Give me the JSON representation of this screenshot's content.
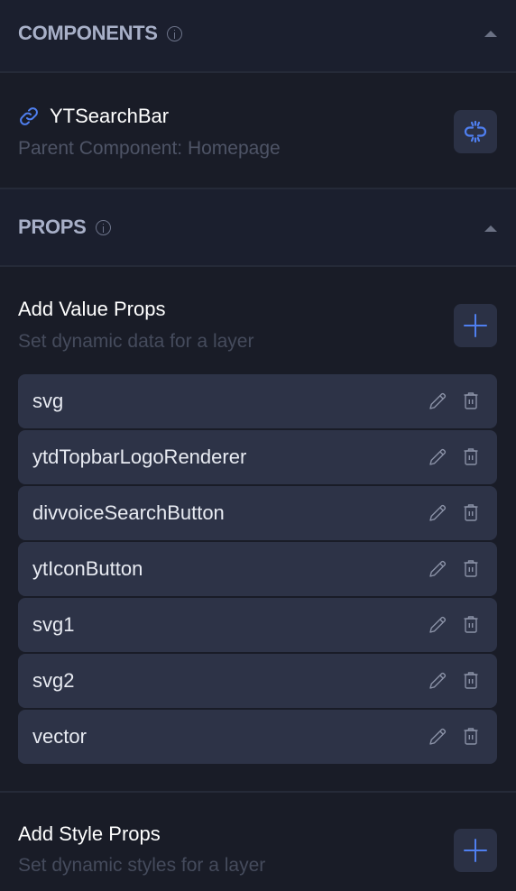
{
  "components_section": {
    "title": "COMPONENTS",
    "info_icon": "info-icon",
    "collapse_icon": "caret-up-icon",
    "component": {
      "icon": "link-icon",
      "name": "YTSearchBar",
      "parent_label": "Parent Component: Homepage",
      "unlink_button_icon": "unlink-icon"
    }
  },
  "props_section": {
    "title": "PROPS",
    "info_icon": "info-icon",
    "collapse_icon": "caret-up-icon",
    "value_props": {
      "title": "Add Value Props",
      "subtitle": "Set dynamic data for a layer",
      "add_button_icon": "plus-icon",
      "items": [
        {
          "name": "svg"
        },
        {
          "name": "ytdTopbarLogoRenderer"
        },
        {
          "name": "divvoiceSearchButton"
        },
        {
          "name": "ytIconButton"
        },
        {
          "name": "svg1"
        },
        {
          "name": "svg2"
        },
        {
          "name": "vector"
        }
      ],
      "item_actions": [
        "edit-icon",
        "trash-icon"
      ]
    },
    "style_props": {
      "title": "Add Style Props",
      "subtitle": "Set dynamic styles for a layer",
      "add_button_icon": "plus-icon"
    }
  },
  "colors": {
    "background": "#191c27",
    "header_background": "#1b1f2e",
    "item_background": "#2d3347",
    "accent": "#4f7ff0",
    "heading_text": "#a8b0c8",
    "muted_text": "#4e5466"
  }
}
